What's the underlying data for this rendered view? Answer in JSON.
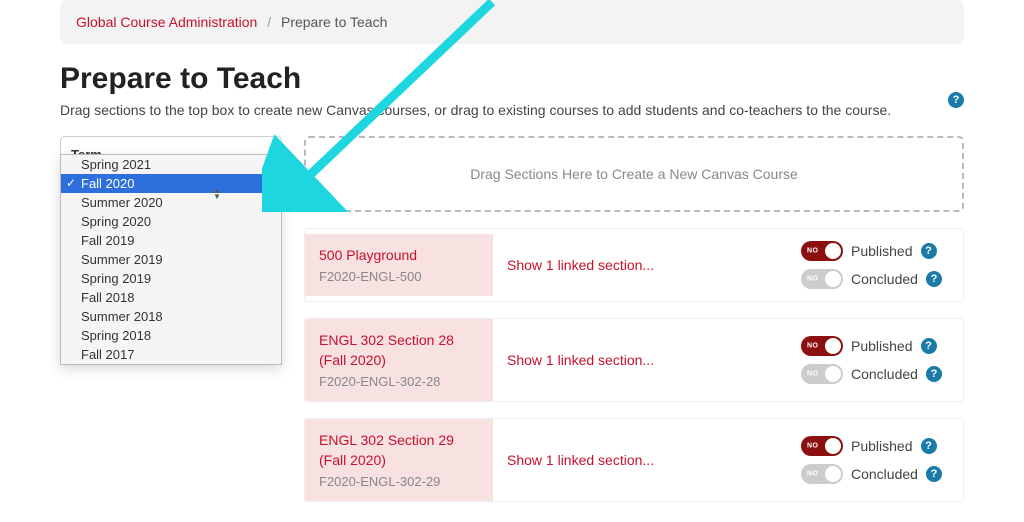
{
  "breadcrumb": {
    "root": "Global Course Administration",
    "current": "Prepare to Teach"
  },
  "page": {
    "title": "Prepare to Teach",
    "subtitle": "Drag sections to the top box to create new Canvas courses, or drag to existing courses to add students and co-teachers to the course."
  },
  "term": {
    "label": "Term",
    "options": [
      "Spring 2021",
      "Fall 2020",
      "Summer 2020",
      "Spring 2020",
      "Fall 2019",
      "Summer 2019",
      "Spring 2019",
      "Fall 2018",
      "Summer 2018",
      "Spring 2018",
      "Fall 2017"
    ],
    "selected": "Fall 2020"
  },
  "dropzone": {
    "text": "Drag Sections Here to Create a New Canvas Course"
  },
  "toggle": {
    "no_label": "NO",
    "published": "Published",
    "concluded": "Concluded"
  },
  "courses": [
    {
      "title": "500 Playground",
      "code": "F2020-ENGL-500",
      "linked": "Show 1 linked section..."
    },
    {
      "title": "ENGL 302 Section 28 (Fall 2020)",
      "code": "F2020-ENGL-302-28",
      "linked": "Show 1 linked section..."
    },
    {
      "title": "ENGL 302 Section 29 (Fall 2020)",
      "code": "F2020-ENGL-302-29",
      "linked": "Show 1 linked section..."
    }
  ]
}
